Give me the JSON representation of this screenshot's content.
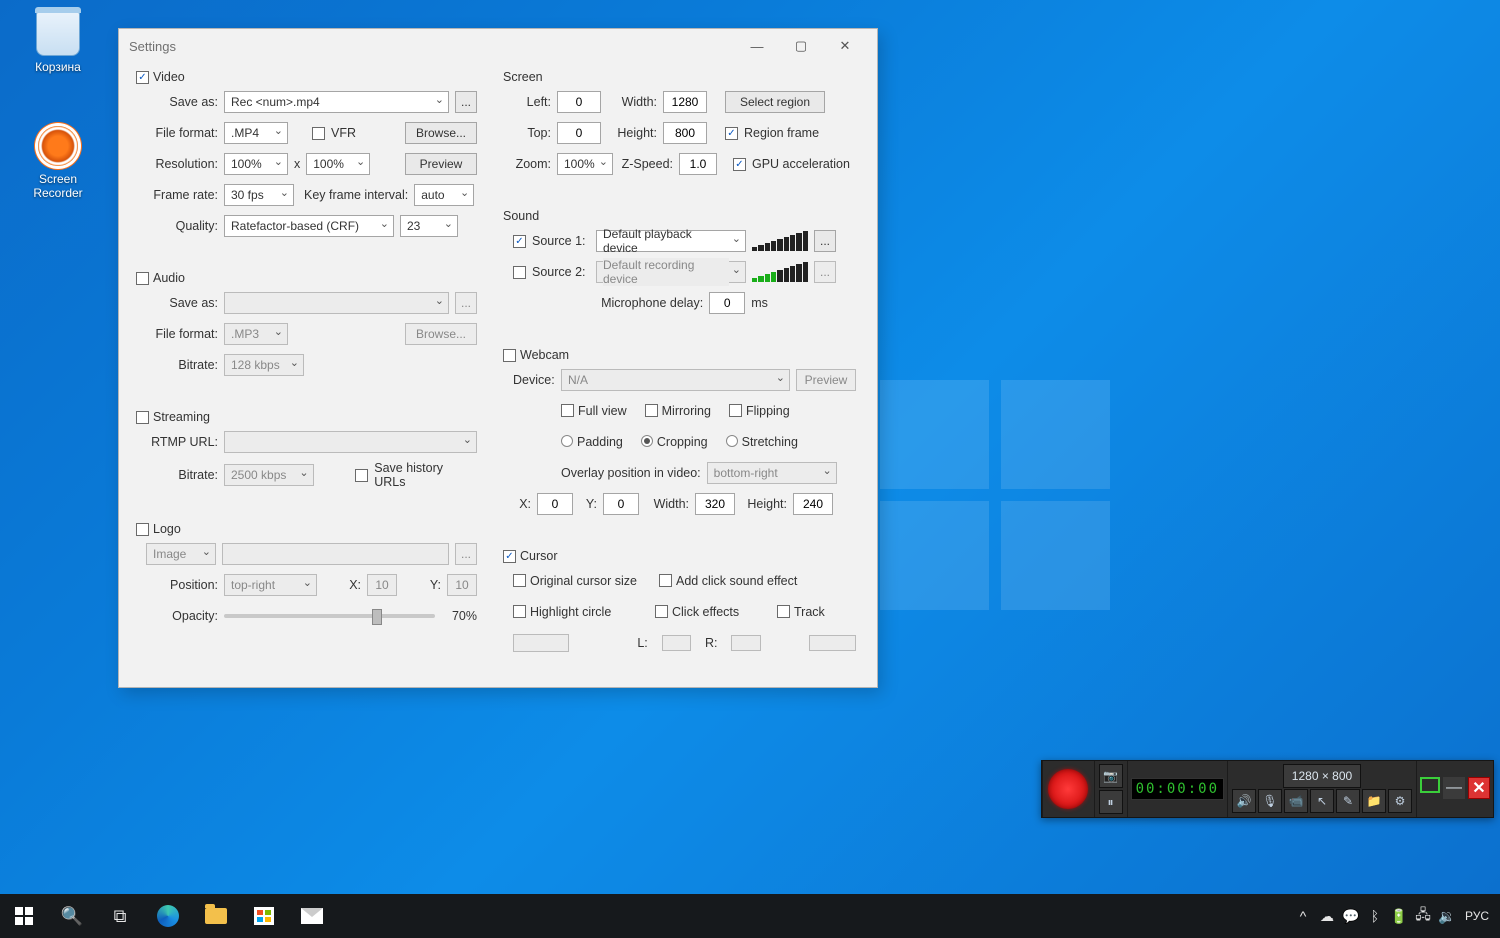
{
  "desktop": {
    "recycle_bin": "Корзина",
    "screen_recorder": "Screen\nRecorder"
  },
  "window": {
    "title": "Settings",
    "video": {
      "title": "Video",
      "checked": true,
      "save_as_label": "Save as:",
      "save_as_value": "Rec <num>.mp4",
      "browse_small": "...",
      "file_format_label": "File format:",
      "file_format_value": ".MP4",
      "vfr_label": "VFR",
      "browse_label": "Browse...",
      "resolution_label": "Resolution:",
      "res_w": "100%",
      "res_x": "x",
      "res_h": "100%",
      "preview_label": "Preview",
      "framerate_label": "Frame rate:",
      "framerate_value": "30 fps",
      "keyframe_label": "Key frame interval:",
      "keyframe_value": "auto",
      "quality_label": "Quality:",
      "quality_mode": "Ratefactor-based (CRF)",
      "quality_value": "23"
    },
    "audio": {
      "title": "Audio",
      "checked": false,
      "save_as_label": "Save as:",
      "save_as_value": "",
      "browse_small": "...",
      "file_format_label": "File format:",
      "file_format_value": ".MP3",
      "browse_label": "Browse...",
      "bitrate_label": "Bitrate:",
      "bitrate_value": "128 kbps"
    },
    "streaming": {
      "title": "Streaming",
      "checked": false,
      "rtmp_label": "RTMP URL:",
      "rtmp_value": "",
      "bitrate_label": "Bitrate:",
      "bitrate_value": "2500 kbps",
      "history_label": "Save history URLs"
    },
    "logo": {
      "title": "Logo",
      "checked": false,
      "type_value": "Image",
      "path_value": "",
      "browse_small": "...",
      "position_label": "Position:",
      "position_value": "top-right",
      "x_label": "X:",
      "x_value": "10",
      "y_label": "Y:",
      "y_value": "10",
      "opacity_label": "Opacity:",
      "opacity_value": "70%"
    },
    "screen": {
      "title": "Screen",
      "left_label": "Left:",
      "left_value": "0",
      "width_label": "Width:",
      "width_value": "1280",
      "select_region": "Select region",
      "top_label": "Top:",
      "top_value": "0",
      "height_label": "Height:",
      "height_value": "800",
      "region_frame": "Region frame",
      "zoom_label": "Zoom:",
      "zoom_value": "100%",
      "zspeed_label": "Z-Speed:",
      "zspeed_value": "1.0",
      "gpu_label": "GPU acceleration"
    },
    "sound": {
      "title": "Sound",
      "src1_label": "Source 1:",
      "src1_value": "Default playback device",
      "src1_checked": true,
      "src2_label": "Source 2:",
      "src2_value": "Default recording device",
      "src2_checked": false,
      "more": "...",
      "mic_delay_label": "Microphone delay:",
      "mic_delay_value": "0",
      "mic_delay_unit": "ms"
    },
    "webcam": {
      "title": "Webcam",
      "checked": false,
      "device_label": "Device:",
      "device_value": "N/A",
      "preview": "Preview",
      "fullview": "Full view",
      "mirroring": "Mirroring",
      "flipping": "Flipping",
      "padding": "Padding",
      "cropping": "Cropping",
      "stretching": "Stretching",
      "overlay_label": "Overlay position in video:",
      "overlay_value": "bottom-right",
      "x_label": "X:",
      "x_value": "0",
      "y_label": "Y:",
      "y_value": "0",
      "width_label": "Width:",
      "width_value": "320",
      "height_label": "Height:",
      "height_value": "240"
    },
    "cursor": {
      "title": "Cursor",
      "checked": true,
      "original_size": "Original cursor size",
      "add_click_sound": "Add click sound effect",
      "highlight": "Highlight circle",
      "click_effects": "Click effects",
      "track": "Track",
      "l_label": "L:",
      "r_label": "R:"
    }
  },
  "recorder_bar": {
    "counter": "00:00:00",
    "dimensions": "1280 × 800"
  },
  "taskbar": {
    "lang": "РУС"
  }
}
